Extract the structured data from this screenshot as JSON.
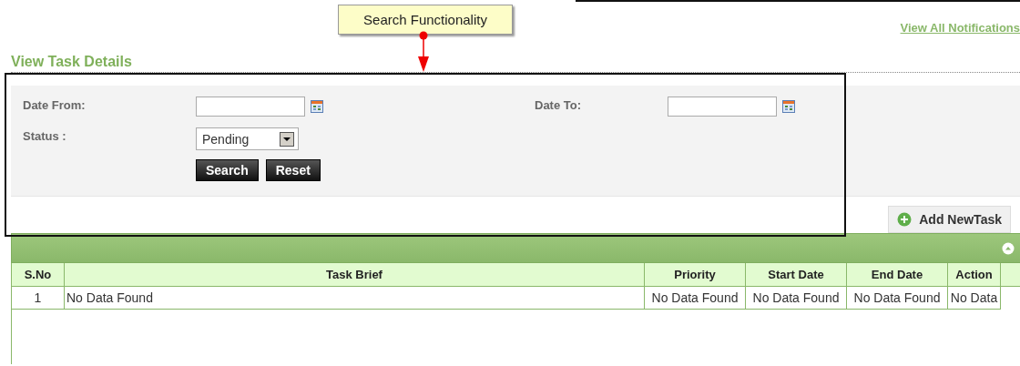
{
  "annotation": {
    "label": "Search Functionality"
  },
  "notifications_link": "View All Notifications",
  "page_title": "View Task Details",
  "search_form": {
    "date_from": {
      "label": "Date From:"
    },
    "date_to": {
      "label": "Date To:"
    },
    "status": {
      "label": "Status :",
      "value": "Pending"
    },
    "buttons": [
      "Search",
      "Reset"
    ]
  },
  "add_button": "Add NewTask",
  "table": {
    "columns": [
      "S.No",
      "Task Brief",
      "Priority",
      "Start Date",
      "End Date",
      "Action"
    ],
    "rows": [
      [
        "1",
        "No Data Found",
        "No Data Found",
        "No Data Found",
        "No Data Found",
        "No Data"
      ]
    ]
  }
}
